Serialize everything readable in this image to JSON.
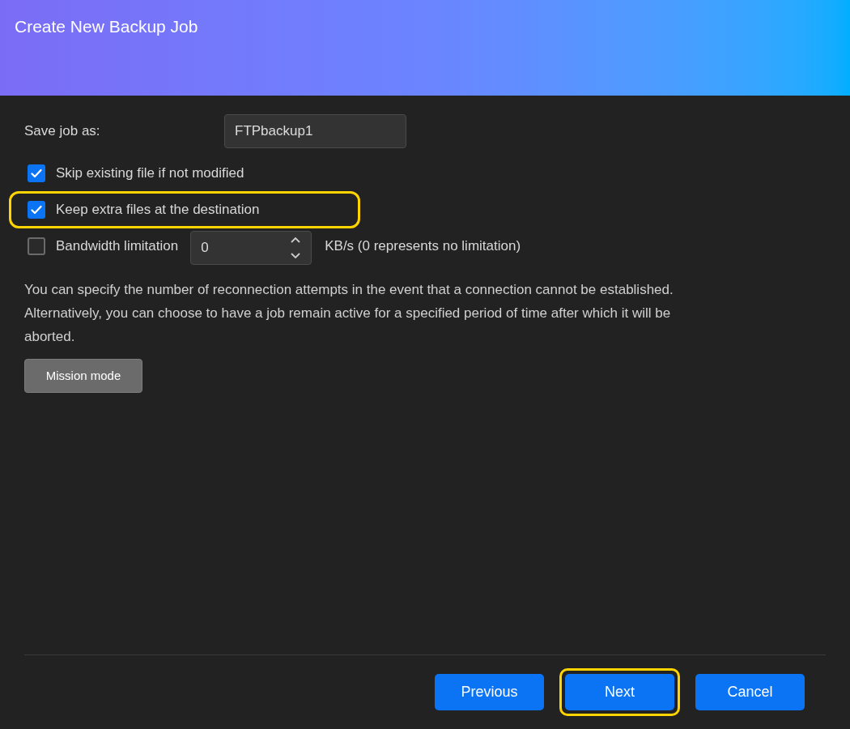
{
  "window": {
    "title": "Create New Backup Job"
  },
  "job_name": {
    "label": "Save job as:",
    "value": "FTPbackup1"
  },
  "options": [
    {
      "kind": "checkbox",
      "label": "Skip existing file if not modified",
      "checked": true,
      "highlighted": false
    },
    {
      "kind": "checkbox",
      "label": "Keep extra files at the destination",
      "checked": true,
      "highlighted": true
    },
    {
      "kind": "checkbox_number",
      "label": "Bandwidth limitation",
      "checked": false,
      "highlighted": false,
      "value": "0",
      "unit": "KB/s (0 represents no limitation)"
    }
  ],
  "description": "You can specify the number of reconnection attempts in the event that a connection cannot be established. Alternatively, you can choose to have a job remain active for a specified period of time after which it will be aborted.",
  "mission_button": "Mission mode",
  "buttons": [
    {
      "label": "Previous",
      "highlighted": false
    },
    {
      "label": "Next",
      "highlighted": true
    },
    {
      "label": "Cancel",
      "highlighted": false
    }
  ]
}
